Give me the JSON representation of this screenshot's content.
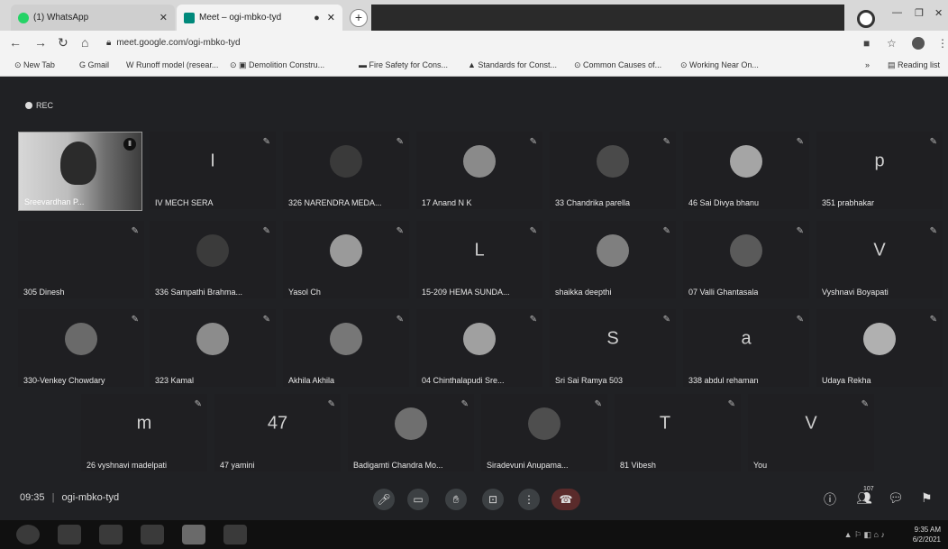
{
  "browser": {
    "tabs": [
      {
        "label": "(1) WhatsApp",
        "fav_color": "#25d366"
      },
      {
        "label": "Meet – ogi-mbko-tyd",
        "fav_color": "#00897b"
      }
    ],
    "url": "meet.google.com/ogi-mbko-tyd",
    "bookmarks": [
      "New Tab",
      "Gmail",
      "Runoff model (resear...",
      "Demolition Constru...",
      "Fire Safety for Cons...",
      "Standards for Const...",
      "Common Causes of...",
      "Working Near On..."
    ],
    "reading_list": "Reading list"
  },
  "meet": {
    "rec_label": "REC",
    "self": {
      "name": "Sreevardhan P..."
    },
    "participants": [
      {
        "name": "IV MECH SERA",
        "letter": "I"
      },
      {
        "name": "326 NARENDRA MEDA...",
        "letter": ""
      },
      {
        "name": "17 Anand N K",
        "letter": ""
      },
      {
        "name": "33 Chandrika parella",
        "letter": ""
      },
      {
        "name": "46 Sai Divya bhanu",
        "letter": ""
      },
      {
        "name": "351 prabhakar",
        "letter": "p"
      },
      {
        "name": "305 Dinesh",
        "letter": ""
      },
      {
        "name": "336 Sampathi Brahma...",
        "letter": ""
      },
      {
        "name": "Yasol Ch",
        "letter": ""
      },
      {
        "name": "15-209 HEMA SUNDA...",
        "letter": "L"
      },
      {
        "name": "shaikka deepthi",
        "letter": ""
      },
      {
        "name": "07 Valli Ghantasala",
        "letter": ""
      },
      {
        "name": "Vyshnavi Boyapati",
        "letter": "V"
      },
      {
        "name": "330-Venkey Chowdary",
        "letter": ""
      },
      {
        "name": "323 Kamal",
        "letter": ""
      },
      {
        "name": "Akhila Akhila",
        "letter": ""
      },
      {
        "name": "04 Chinthalapudi Sre...",
        "letter": ""
      },
      {
        "name": "Sri Sai Ramya 503",
        "letter": "S"
      },
      {
        "name": "338 abdul rehaman",
        "letter": "a"
      },
      {
        "name": "Udaya Rekha",
        "letter": ""
      },
      {
        "name": "26 vyshnavi madelpati",
        "letter": "m"
      },
      {
        "name": "47 yamini",
        "letter": "47"
      },
      {
        "name": "Badigamti Chandra Mo...",
        "letter": ""
      },
      {
        "name": "Siradevuni Anupama...",
        "letter": ""
      },
      {
        "name": "81 Vibesh",
        "letter": "T"
      },
      {
        "name": "You",
        "letter": "V"
      }
    ],
    "time": "09:35",
    "meeting_code": "ogi-mbko-tyd",
    "participant_count": "107"
  },
  "taskbar": {
    "time": "9:35 AM",
    "date": "6/2/2021"
  }
}
